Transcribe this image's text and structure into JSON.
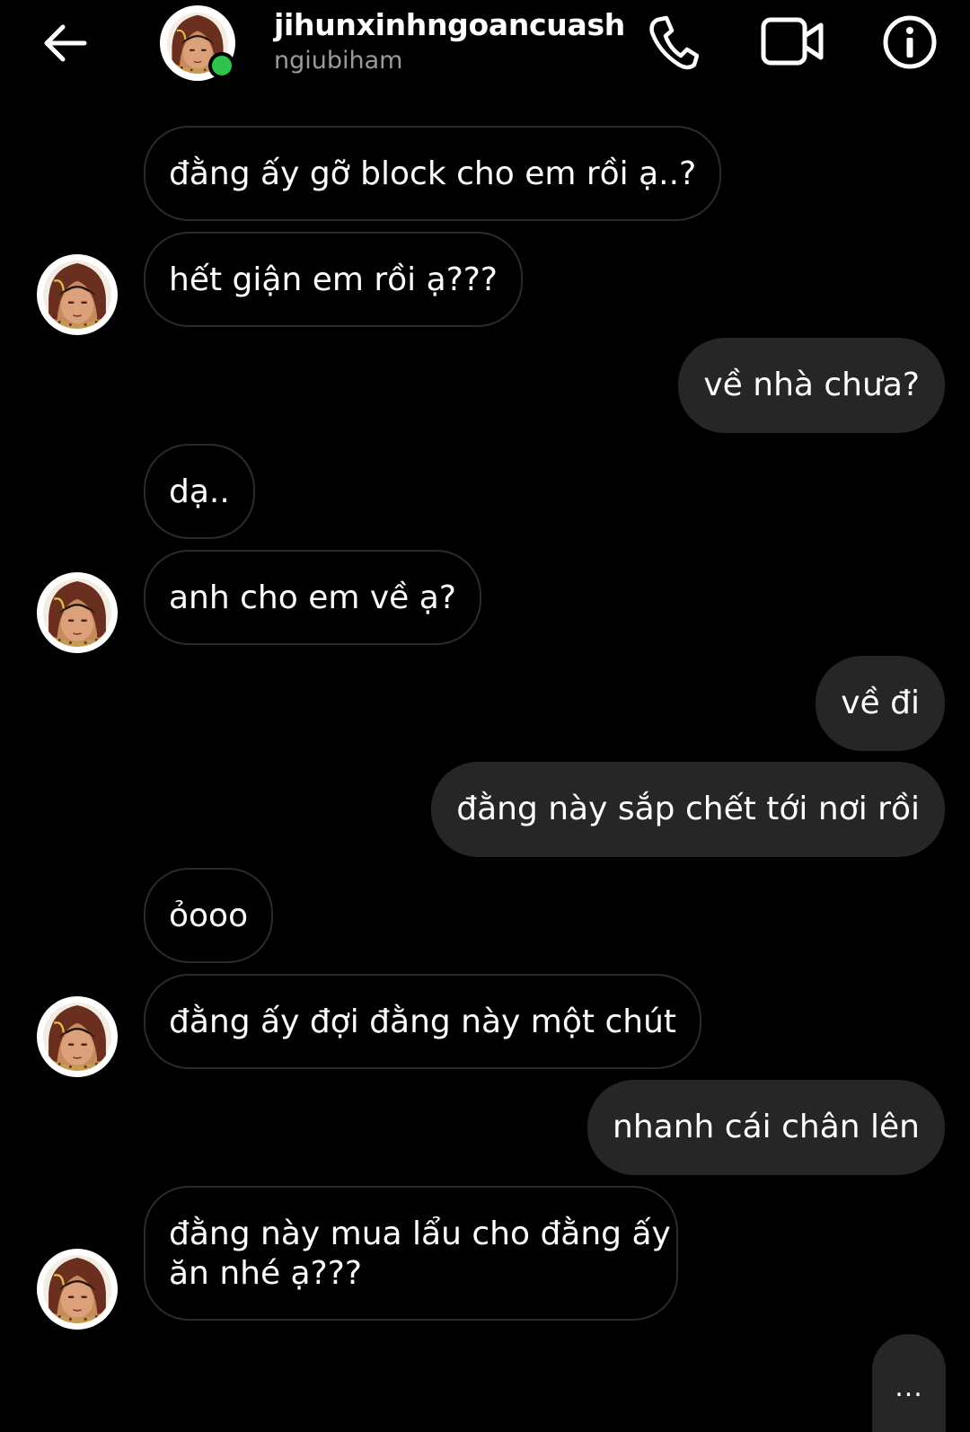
{
  "header": {
    "display_name": "jihunxinhngoancuash",
    "username": "ngiubiham",
    "online": true,
    "icons": [
      "back-arrow-icon",
      "phone-icon",
      "video-camera-icon",
      "info-icon"
    ]
  },
  "colors": {
    "background": "#000000",
    "sent_bubble": "#262626",
    "received_border": "#2b2b2b",
    "online": "#2ec44c",
    "secondary_text": "#9a9a9a"
  },
  "messages": [
    {
      "side": "received",
      "text": "đằng ấy gỡ block cho em rồi ạ..?"
    },
    {
      "side": "received",
      "text": "hết giận em rồi ạ???"
    },
    {
      "side": "sent",
      "text": "về nhà chưa?"
    },
    {
      "side": "received",
      "text": "dạ.."
    },
    {
      "side": "received",
      "text": "anh cho em về ạ?"
    },
    {
      "side": "sent",
      "text": "về đi"
    },
    {
      "side": "sent",
      "text": "đằng này sắp chết tới nơi rồi"
    },
    {
      "side": "received",
      "text": "ỏooo"
    },
    {
      "side": "received",
      "text": "đằng ấy đợi đằng này một chút"
    },
    {
      "side": "sent",
      "text": "nhanh cái chân lên"
    },
    {
      "side": "received",
      "lines": [
        "đằng này mua lẩu cho đằng ấy",
        "ăn nhé ạ???"
      ]
    }
  ],
  "typing_indicator": "..."
}
